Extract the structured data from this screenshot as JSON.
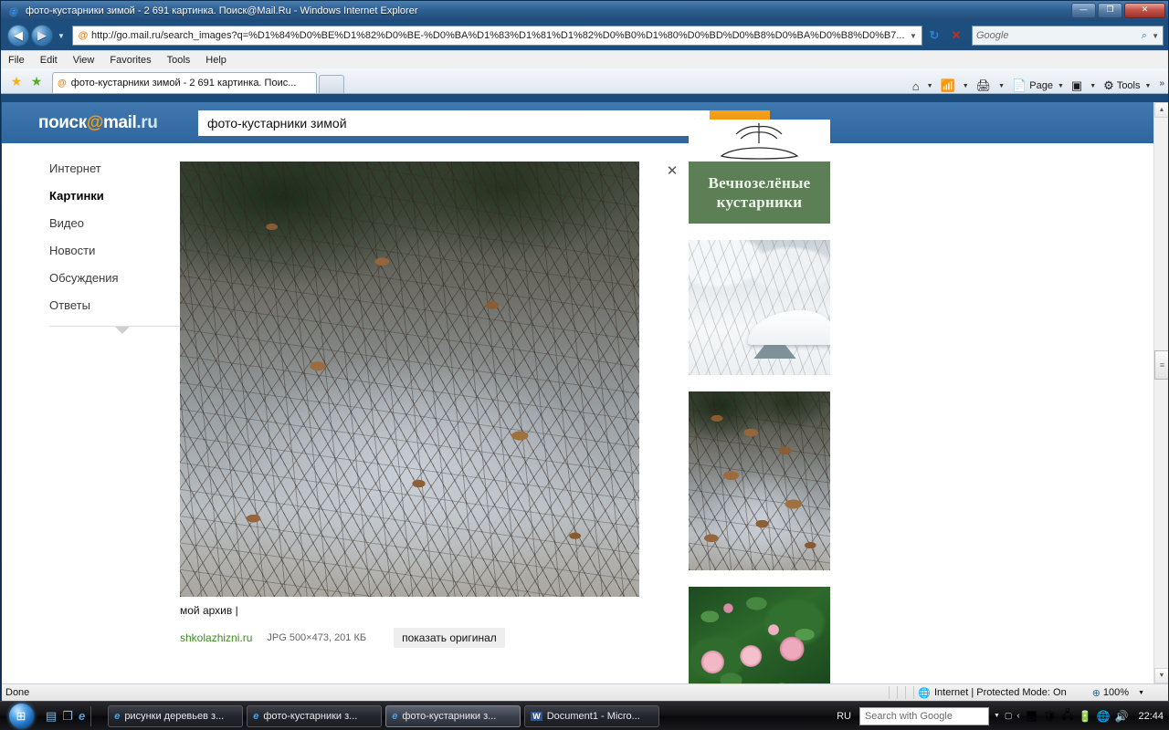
{
  "window": {
    "title": "фото-кустарники зимой - 2 691 картинка. Поиск@Mail.Ru - Windows Internet Explorer",
    "minimize_label": "—",
    "restore_label": "❐",
    "close_label": "✕"
  },
  "browser": {
    "back_label": "◀",
    "forward_label": "▶",
    "history_caret": "▼",
    "address_icon": "@",
    "address_value": "http://go.mail.ru/search_images?q=%D1%84%D0%BE%D1%82%D0%BE-%D0%BA%D1%83%D1%81%D1%82%D0%B0%D1%80%D0%BD%D0%B8%D0%BA%D0%B8%D0%B7...",
    "address_caret": "▼",
    "refresh_label": "↻",
    "stop_label": "✕",
    "search_placeholder": "Google",
    "search_icon": "⌕",
    "search_caret": "▼",
    "menu": [
      "File",
      "Edit",
      "View",
      "Favorites",
      "Tools",
      "Help"
    ],
    "fav_add_label": "★",
    "fav_star_label": "★",
    "tab": {
      "icon": "@",
      "label": "фото-кустарники зимой - 2 691 картинка. Поис..."
    },
    "toolbar": {
      "home_icon": "⌂",
      "feeds_icon": "📶",
      "print_icon": "🖨",
      "page_label": "Page",
      "page_icon": "📄",
      "safety_icon": "▣",
      "tools_label": "Tools",
      "tools_icon": "⚙",
      "caret": "▼",
      "chevrons": "»"
    }
  },
  "mailru": {
    "logo_prefix": "поиск",
    "logo_at": "@",
    "logo_mail": "mail",
    "logo_ru": ".ru",
    "query": "фото-кустарники зимой",
    "clear_label": "✕",
    "submit_icon": "⌕",
    "sidebar": [
      {
        "label": "Интернет",
        "active": false
      },
      {
        "label": "Картинки",
        "active": true
      },
      {
        "label": "Видео",
        "active": false
      },
      {
        "label": "Новости",
        "active": false
      },
      {
        "label": "Обсуждения",
        "active": false
      },
      {
        "label": "Ответы",
        "active": false
      }
    ],
    "sidebar_more_icon": "▼",
    "result": {
      "caption_title": "мой архив |",
      "source": "shkolazhizni.ru",
      "meta": "JPG 500×473, 201 КБ",
      "show_original_label": "показать оригинал",
      "image_alt": "winter-shrub-photo"
    },
    "rail": {
      "close_label": "✕",
      "thumbs": [
        {
          "name": "evergreen-shrubs-banner",
          "line1": "Вечнозелёные",
          "line2": "кустарники"
        },
        {
          "name": "snowy-garden-shed",
          "line1": "",
          "line2": ""
        },
        {
          "name": "winter-shrub-thumb",
          "line1": "",
          "line2": ""
        },
        {
          "name": "pink-roses-bush",
          "line1": "",
          "line2": ""
        }
      ]
    }
  },
  "scrollbar": {
    "up_label": "▲",
    "down_label": "▼",
    "thumb_label": "≡"
  },
  "status": {
    "text": "Done",
    "zone_icon": "🌐",
    "zone_text": "Internet | Protected Mode: On",
    "zoom_icon": "⊕",
    "zoom_value": "100%",
    "zoom_caret": "▼"
  },
  "taskbar": {
    "start_icon": "⊞",
    "quicklaunch": [
      {
        "name": "show-desktop-icon",
        "glyph": "▤"
      },
      {
        "name": "switch-windows-icon",
        "glyph": "❐"
      },
      {
        "name": "internet-explorer-icon",
        "glyph": "e"
      }
    ],
    "tasks": [
      {
        "name": "task-ie-risunki",
        "icon": "e",
        "type": "ie",
        "label": "рисунки деревьев з...",
        "active": false
      },
      {
        "name": "task-ie-kustarniki-1",
        "icon": "e",
        "type": "ie",
        "label": "фото-кустарники з...",
        "active": false
      },
      {
        "name": "task-ie-kustarniki-2",
        "icon": "e",
        "type": "ie",
        "label": "фото-кустарники з...",
        "active": true
      },
      {
        "name": "task-word-document1",
        "icon": "W",
        "type": "word",
        "label": "Document1 - Micro...",
        "active": false
      }
    ],
    "language": "RU",
    "search_placeholder": "Search with Google",
    "tray_caret": "▼",
    "tray_box": "▢",
    "tray_chevron": "‹",
    "tray_icons": [
      {
        "name": "network-monitor-icon",
        "glyph": "🖥"
      },
      {
        "name": "antivirus-icon",
        "glyph": "🛡"
      },
      {
        "name": "utility-icon",
        "glyph": "🖧"
      },
      {
        "name": "battery-icon",
        "glyph": "🔋"
      },
      {
        "name": "network-icon",
        "glyph": "🌐"
      },
      {
        "name": "volume-icon",
        "glyph": "🔊"
      }
    ],
    "clock": "22:44"
  }
}
